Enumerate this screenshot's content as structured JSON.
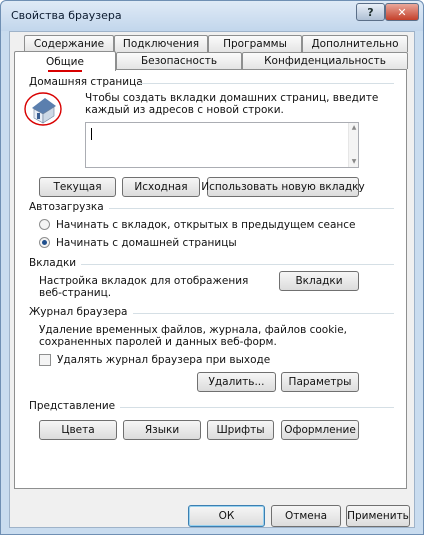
{
  "window": {
    "title": "Свойства браузера",
    "help_glyph": "?",
    "close_glyph": "✕"
  },
  "tabs": {
    "row_top": [
      "Содержание",
      "Подключения",
      "Программы",
      "Дополнительно"
    ],
    "row_bottom": [
      "Общие",
      "Безопасность",
      "Конфиденциальность"
    ],
    "active": "Общие"
  },
  "home_page": {
    "group_label": "Домашняя страница",
    "description_line1": "Чтобы создать вкладки домашних страниц, введите",
    "description_line2": "каждый из адресов с новой строки.",
    "url_value": "",
    "buttons": [
      "Текущая",
      "Исходная",
      "Использовать новую вкладку"
    ]
  },
  "startup": {
    "group_label": "Автозагрузка",
    "options": [
      {
        "label": "Начинать с вкладок, открытых в предыдущем сеансе",
        "selected": false
      },
      {
        "label": "Начинать с домашней страницы",
        "selected": true
      }
    ]
  },
  "tabs_section": {
    "group_label": "Вкладки",
    "description_line1": "Настройка вкладок для отображения",
    "description_line2": "веб-страниц.",
    "button": "Вкладки"
  },
  "history": {
    "group_label": "Журнал браузера",
    "description_line1": "Удаление временных файлов, журнала, файлов cookie,",
    "description_line2": "сохраненных паролей и данных веб-форм.",
    "checkbox_label": "Удалять журнал браузера при выходе",
    "checkbox_checked": false,
    "delete_button": "Удалить...",
    "settings_button": "Параметры"
  },
  "appearance": {
    "group_label": "Представление",
    "buttons": [
      "Цвета",
      "Языки",
      "Шрифты",
      "Оформление"
    ]
  },
  "footer": {
    "ok": "ОК",
    "cancel": "Отмена",
    "apply": "Применить"
  },
  "colors": {
    "annotation_red": "#d80000",
    "window_frame": "#c9dcef",
    "dialog_face": "#f0f0f0"
  }
}
